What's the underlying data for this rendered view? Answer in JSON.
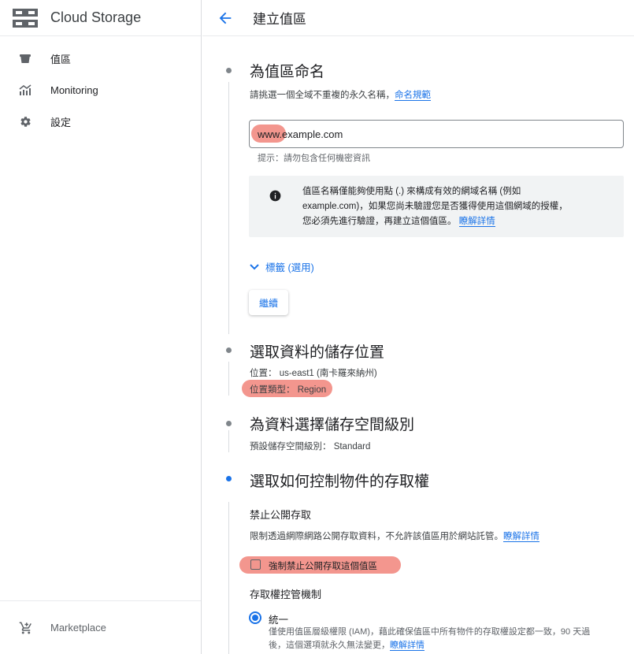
{
  "app": {
    "title": "Cloud Storage"
  },
  "sidebar": {
    "items": [
      {
        "label": "值區",
        "icon": "bucket-icon"
      },
      {
        "label": "Monitoring",
        "icon": "chart-icon"
      },
      {
        "label": "設定",
        "icon": "gear-icon"
      }
    ],
    "bottom": {
      "label": "Marketplace",
      "icon": "cart-icon"
    }
  },
  "header": {
    "title": "建立值區"
  },
  "steps": {
    "name": {
      "title": "為值區命名",
      "desc": "請挑選一個全域不重複的永久名稱，",
      "desc_link": "命名規範",
      "input_value": "www.example.com",
      "hint": "提示：請勿包含任何機密資訊",
      "info_line1": "值區名稱僅能夠使用點 (.) 來構成有效的網域名稱 (例如",
      "info_line2": "example.com)，如果您尚未驗證您是否獲得使用這個網域的授權，",
      "info_line3": "您必須先進行驗證，再建立這個值區。",
      "info_link": "瞭解詳情",
      "labels_toggle": "標籤 (選用)",
      "continue_label": "繼續"
    },
    "location": {
      "title": "選取資料的儲存位置",
      "line1": "位置： us-east1 (南卡羅來納州)",
      "line2": "位置類型： Region"
    },
    "storage_class": {
      "title": "為資料選擇儲存空間級別",
      "line1": "預設儲存空間級別： Standard"
    },
    "access": {
      "title": "選取如何控制物件的存取權",
      "public_heading": "禁止公開存取",
      "public_desc": "限制透過網際網路公開存取資料，不允許該值區用於網站託管。",
      "public_link": "瞭解詳情",
      "enforce_label": "強制禁止公開存取這個值區",
      "enforce_checked": false,
      "acl_heading": "存取權控管機制",
      "uniform_label": "統一",
      "uniform_desc1": "僅使用值區層級權限 (IAM)，藉此確保值區中所有物件的存取權設定都一致，90 天過",
      "uniform_desc2": "後，這個選項就永久無法變更，",
      "uniform_link": "瞭解詳情",
      "uniform_selected": true
    }
  },
  "colors": {
    "accent": "#1a73e8",
    "highlight": "#f28b82"
  }
}
